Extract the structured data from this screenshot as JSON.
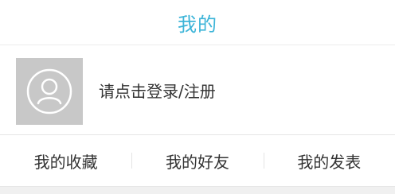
{
  "header": {
    "title": "我的",
    "title_color": "#3cb4d8"
  },
  "profile": {
    "avatar_icon": "user-avatar-icon",
    "login_prompt": "请点击登录/注册"
  },
  "tabs": [
    {
      "label": "我的收藏"
    },
    {
      "label": "我的好友"
    },
    {
      "label": "我的发表"
    }
  ]
}
